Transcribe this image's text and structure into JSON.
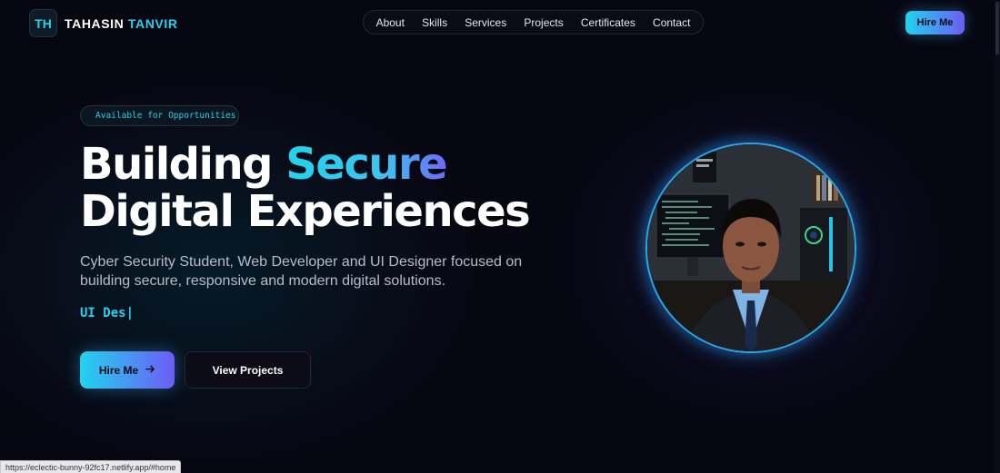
{
  "header": {
    "logo_initials": "TH",
    "logo_first": "TAHASIN",
    "logo_last": "TANVIR",
    "nav": [
      "About",
      "Skills",
      "Services",
      "Projects",
      "Certificates",
      "Contact"
    ],
    "hire_label": "Hire Me"
  },
  "hero": {
    "status": "Available for Opportunities",
    "headline_line1_a": "Building ",
    "headline_line1_b": "Secure",
    "headline_line2": "Digital Experiences",
    "subtitle": "Cyber Security Student, Web Developer and UI Designer focused on building secure, responsive and modern digital solutions.",
    "typed": "UI Des",
    "cursor": "|",
    "primary_button": "Hire Me",
    "secondary_button": "View Projects"
  },
  "browser": {
    "status_url": "https://eclectic-bunny-92fc17.netlify.app/#home"
  },
  "colors": {
    "accent_cyan": "#22d3ee",
    "accent_purple": "#6d5cf6",
    "background": "#070712"
  }
}
